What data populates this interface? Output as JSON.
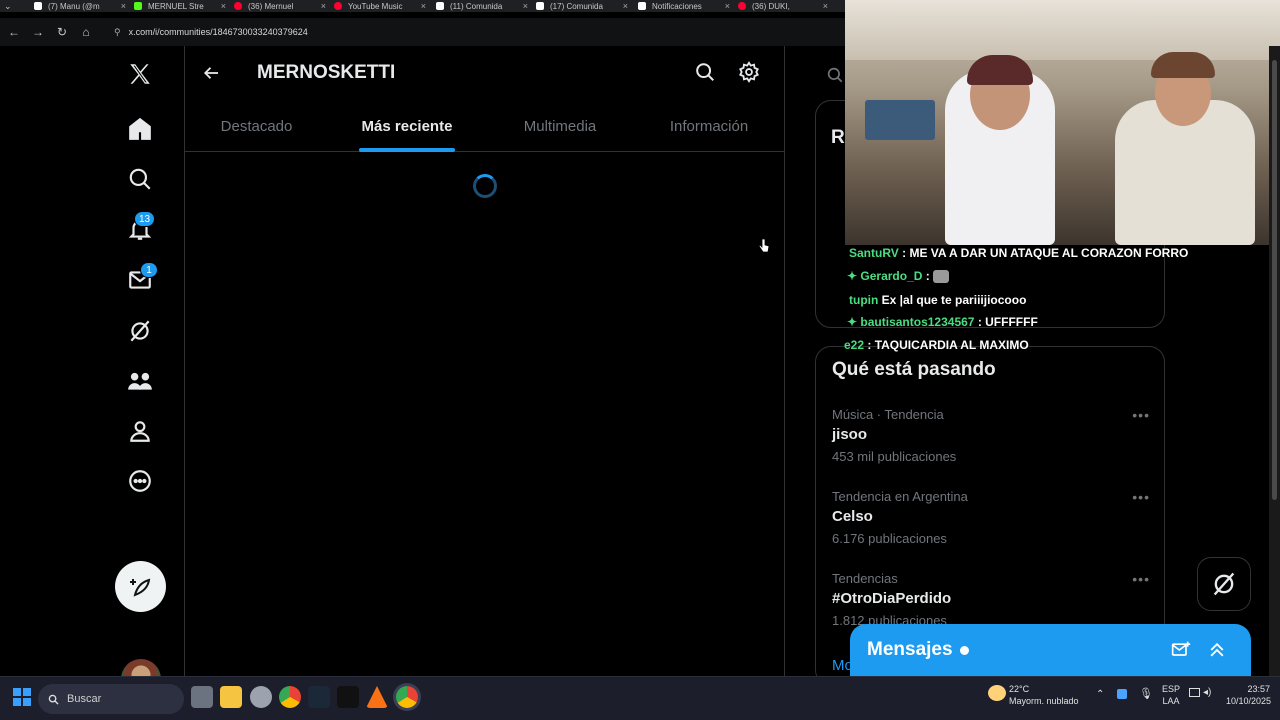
{
  "browser": {
    "tabs": [
      {
        "label": "(7) Manu (@m",
        "color": "#ffffff"
      },
      {
        "label": "MERNUEL Stre",
        "color": "#53fc18"
      },
      {
        "label": "(36) Mernuel",
        "color": "#ff0033"
      },
      {
        "label": "YouTube Music",
        "color": "#ff0033"
      },
      {
        "label": "(11) Comunida",
        "color": "#ffffff"
      },
      {
        "label": "(17) Comunida",
        "color": "#ffffff"
      },
      {
        "label": "Notificaciones",
        "color": "#ffffff"
      },
      {
        "label": "(36) DUKI,",
        "color": "#ff0033"
      }
    ],
    "url": "x.com/i/communities/1846730033240379624"
  },
  "nav": {
    "notifications_badge": "13",
    "messages_badge": "1"
  },
  "community": {
    "title": "MERNOSKETTI",
    "tabs": [
      {
        "label": "Destacado",
        "active": false
      },
      {
        "label": "Más reciente",
        "active": true
      },
      {
        "label": "Multimedia",
        "active": false
      },
      {
        "label": "Información",
        "active": false
      }
    ]
  },
  "right": {
    "partial_heading": "R",
    "trends_title": "Qué está pasando",
    "trends": [
      {
        "context": "Música · Tendencia",
        "name": "jisoo",
        "count": "453 mil publicaciones"
      },
      {
        "context": "Tendencia en Argentina",
        "name": "Celso",
        "count": "6.176 publicaciones"
      },
      {
        "context": "Tendencias",
        "name": "#OtroDiaPerdido",
        "count": "1.812 publicaciones"
      }
    ],
    "show_more_partial": "Mo"
  },
  "chat": [
    {
      "user": "SantuRV",
      "msg": ": ME VA A DAR UN ATAQUE AL CORAZON FORRO"
    },
    {
      "user": "Gerardo_D",
      "msg": ":"
    },
    {
      "user": "tupin",
      "msg": "Ex |al que te pariiijiocooo"
    },
    {
      "user": "bautisantos1234567",
      "msg": ": UFFFFFF"
    },
    {
      "user": "e22",
      "msg": ": TAQUICARDIA AL MAXIMO"
    }
  ],
  "messages": {
    "label": "Mensajes"
  },
  "taskbar": {
    "search_label": "Buscar",
    "weather_temp": "22°C",
    "weather_desc": "Mayorm. nublado",
    "lang_1": "ESP",
    "lang_2": "LAA",
    "time": "23:57",
    "date": "10/10/2025"
  }
}
